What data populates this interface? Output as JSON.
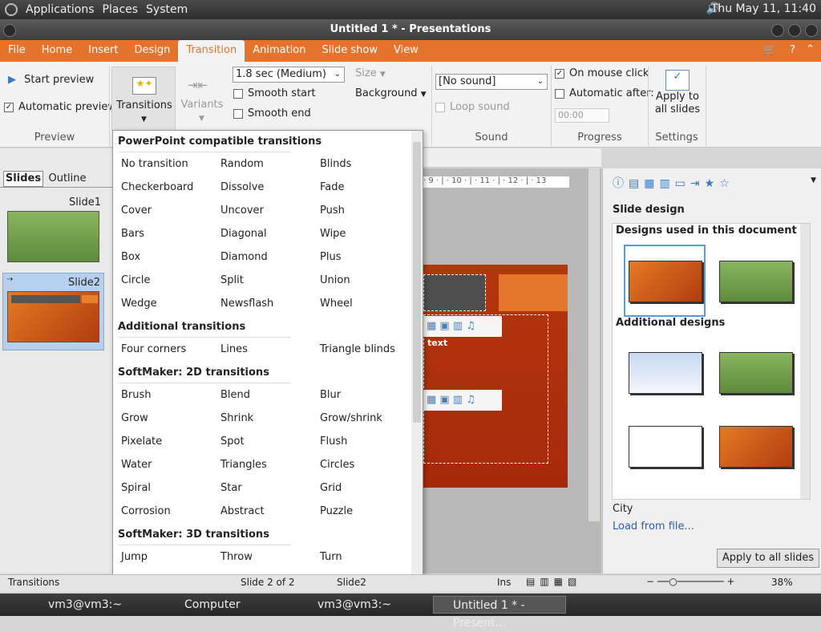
{
  "topbar": {
    "menus": [
      "Applications",
      "Places",
      "System"
    ],
    "clock": "Thu May 11, 11:40"
  },
  "window": {
    "title": "Untitled 1 * - Presentations"
  },
  "menubar": {
    "items": [
      "File",
      "Home",
      "Insert",
      "Design",
      "Transition",
      "Animation",
      "Slide show",
      "View"
    ],
    "active": "Transition"
  },
  "ribbon": {
    "preview": {
      "start_label": "Start preview",
      "auto_label": "Automatic preview",
      "group": "Preview"
    },
    "transitions_label": "Transitions",
    "variants_label": "Variants",
    "duration": "1.8 sec (Medium)",
    "smooth_start": "Smooth start",
    "smooth_end": "Smooth end",
    "size": "Size",
    "background": "Background",
    "sound": {
      "value": "[No sound]",
      "loop": "Loop sound",
      "group": "Sound"
    },
    "progress": {
      "on_click": "On mouse click",
      "auto_after": "Automatic after:",
      "time": "00:00",
      "group": "Progress"
    },
    "settings": {
      "apply_label": "Apply to all slides",
      "group": "Settings"
    }
  },
  "slides_panel": {
    "tabs": [
      "Slides",
      "Outline"
    ],
    "slides": [
      "Slide1",
      "Slide2"
    ]
  },
  "ruler": "· 9 · | · 10 · | · 11 · | · 12 · | · 13",
  "canvas_text": "text",
  "dropdown": {
    "sections": [
      {
        "title": "PowerPoint compatible transitions",
        "items": [
          "No transition",
          "Random",
          "Blinds",
          "Checkerboard",
          "Dissolve",
          "Fade",
          "Cover",
          "Uncover",
          "Push",
          "Bars",
          "Diagonal",
          "Wipe",
          "Box",
          "Diamond",
          "Plus",
          "Circle",
          "Split",
          "Union",
          "Wedge",
          "Newsflash",
          "Wheel"
        ]
      },
      {
        "title": "Additional transitions",
        "items": [
          "Four corners",
          "Lines",
          "Triangle blinds"
        ]
      },
      {
        "title": "SoftMaker: 2D transitions",
        "items": [
          "Brush",
          "Blend",
          "Blur",
          "Grow",
          "Shrink",
          "Grow/shrink",
          "Pixelate",
          "Spot",
          "Flush",
          "Water",
          "Triangles",
          "Circles",
          "Spiral",
          "Star",
          "Grid",
          "Corrosion",
          "Abstract",
          "Puzzle"
        ]
      },
      {
        "title": "SoftMaker: 3D transitions",
        "items": [
          "Jump",
          "Throw",
          "Turn"
        ]
      }
    ]
  },
  "right_panel": {
    "title": "Slide design",
    "used": "Designs used in this document",
    "additional": "Additional designs",
    "selected_name": "City",
    "load_link": "Load from file...",
    "apply_btn": "Apply to all slides"
  },
  "statusbar": {
    "left": "Transitions",
    "slide": "Slide 2 of 2",
    "slide_name": "Slide2",
    "mode": "Ins",
    "zoom": "38%"
  },
  "taskbar": {
    "items": [
      "vm3@vm3:~",
      "Computer",
      "vm3@vm3:~",
      "Untitled 1 * - Present..."
    ]
  },
  "colors": {
    "accent": "#e5732c",
    "orange_slide": "#c34d14",
    "green_slide": "#6a9a4a"
  }
}
